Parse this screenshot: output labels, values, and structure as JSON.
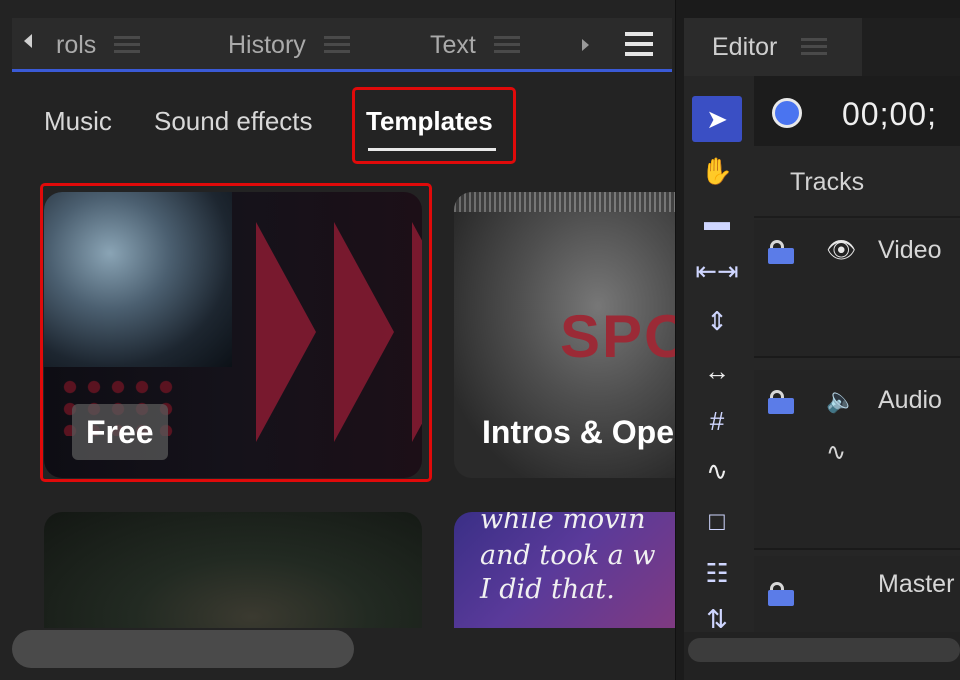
{
  "left_panel": {
    "tabs": [
      {
        "label": "rols"
      },
      {
        "label": "History"
      },
      {
        "label": "Text"
      }
    ],
    "subtabs": [
      "Music",
      "Sound effects",
      "Templates"
    ],
    "active_subtab": "Templates",
    "cards": [
      {
        "label": "Free"
      },
      {
        "label": "Intros & Ope",
        "overlay_text": "SPO"
      },
      {
        "label": ""
      },
      {
        "quote_lines": [
          "while movin",
          "and took a w",
          "I did that."
        ]
      }
    ]
  },
  "editor": {
    "tab_label": "Editor",
    "timecode": "00;00;",
    "tracks_label": "Tracks",
    "tracks": [
      {
        "label": "Video",
        "icon": "eye-icon"
      },
      {
        "label": "Audio",
        "icon": "speaker-icon"
      },
      {
        "label": "Master",
        "icon": ""
      }
    ],
    "tools": [
      "select-arrow-icon",
      "hand-icon",
      "razor-icon",
      "ripple-icon",
      "slip-icon",
      "stretch-icon",
      "grid-icon",
      "envelope-icon",
      "selection-box-icon",
      "mixer-icon",
      "more-icon"
    ]
  },
  "colors": {
    "accent": "#3a5ad6",
    "highlight": "#e00a0a",
    "tool_active": "#3a4fc4"
  }
}
